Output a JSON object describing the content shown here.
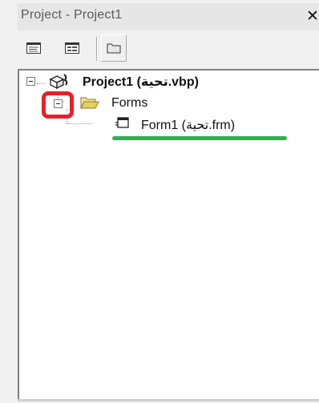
{
  "window": {
    "title": "Project - Project1",
    "close_glyph": "✕"
  },
  "toolbar": {
    "buttons": [
      {
        "icon": "view-code-icon"
      },
      {
        "icon": "view-object-icon"
      },
      {
        "icon": "toggle-folders-icon"
      }
    ]
  },
  "tree": {
    "project": {
      "label": "Project1 (تحية.vbp)",
      "expanded": true
    },
    "forms_folder": {
      "label": "Forms",
      "expanded": true
    },
    "form_item": {
      "label": "Form1 (تحية.frm)"
    }
  },
  "annotations": {
    "highlight_color": "#e8202a",
    "underline_color": "#2bb24c"
  }
}
